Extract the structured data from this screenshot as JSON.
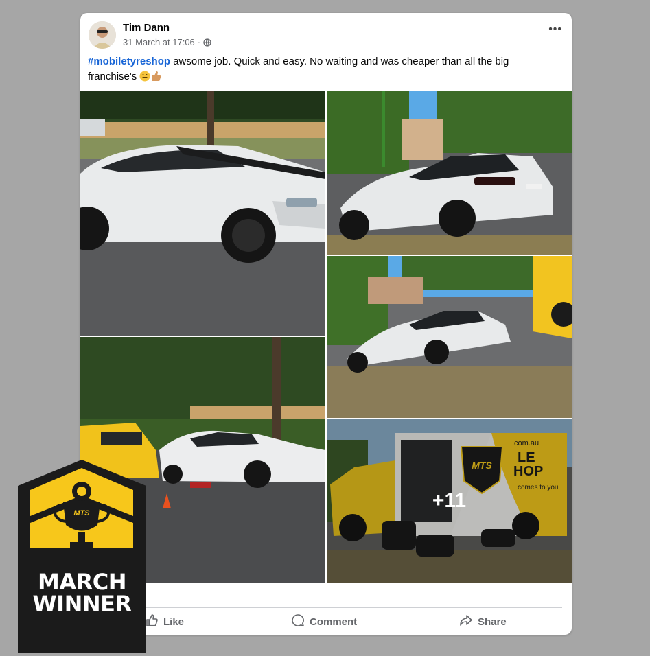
{
  "post": {
    "author": "Tim Dann",
    "timestamp": "31 March at 17:06",
    "separator": "·",
    "more_label": "•••",
    "hashtag": "#mobiletyreshop",
    "body_text": " awsome job.  Quick and easy.  No waiting and was cheaper than all the big franchise's "
  },
  "photos": {
    "more_count": "+11",
    "van_domain": ".com.au",
    "van_brand_line1": "LE",
    "van_brand_line2": "HOP",
    "van_tagline": "comes to you",
    "van_logo": "MTS"
  },
  "actions": {
    "like": "Like",
    "comment": "Comment",
    "share": "Share"
  },
  "badge": {
    "line1": "MARCH",
    "line2": "WINNER",
    "logo_text": "MTS"
  },
  "colors": {
    "hashtag": "#1865d6",
    "badge_yellow": "#f7c71b",
    "badge_dark": "#1b1b1b",
    "background": "#a6a6a6"
  }
}
